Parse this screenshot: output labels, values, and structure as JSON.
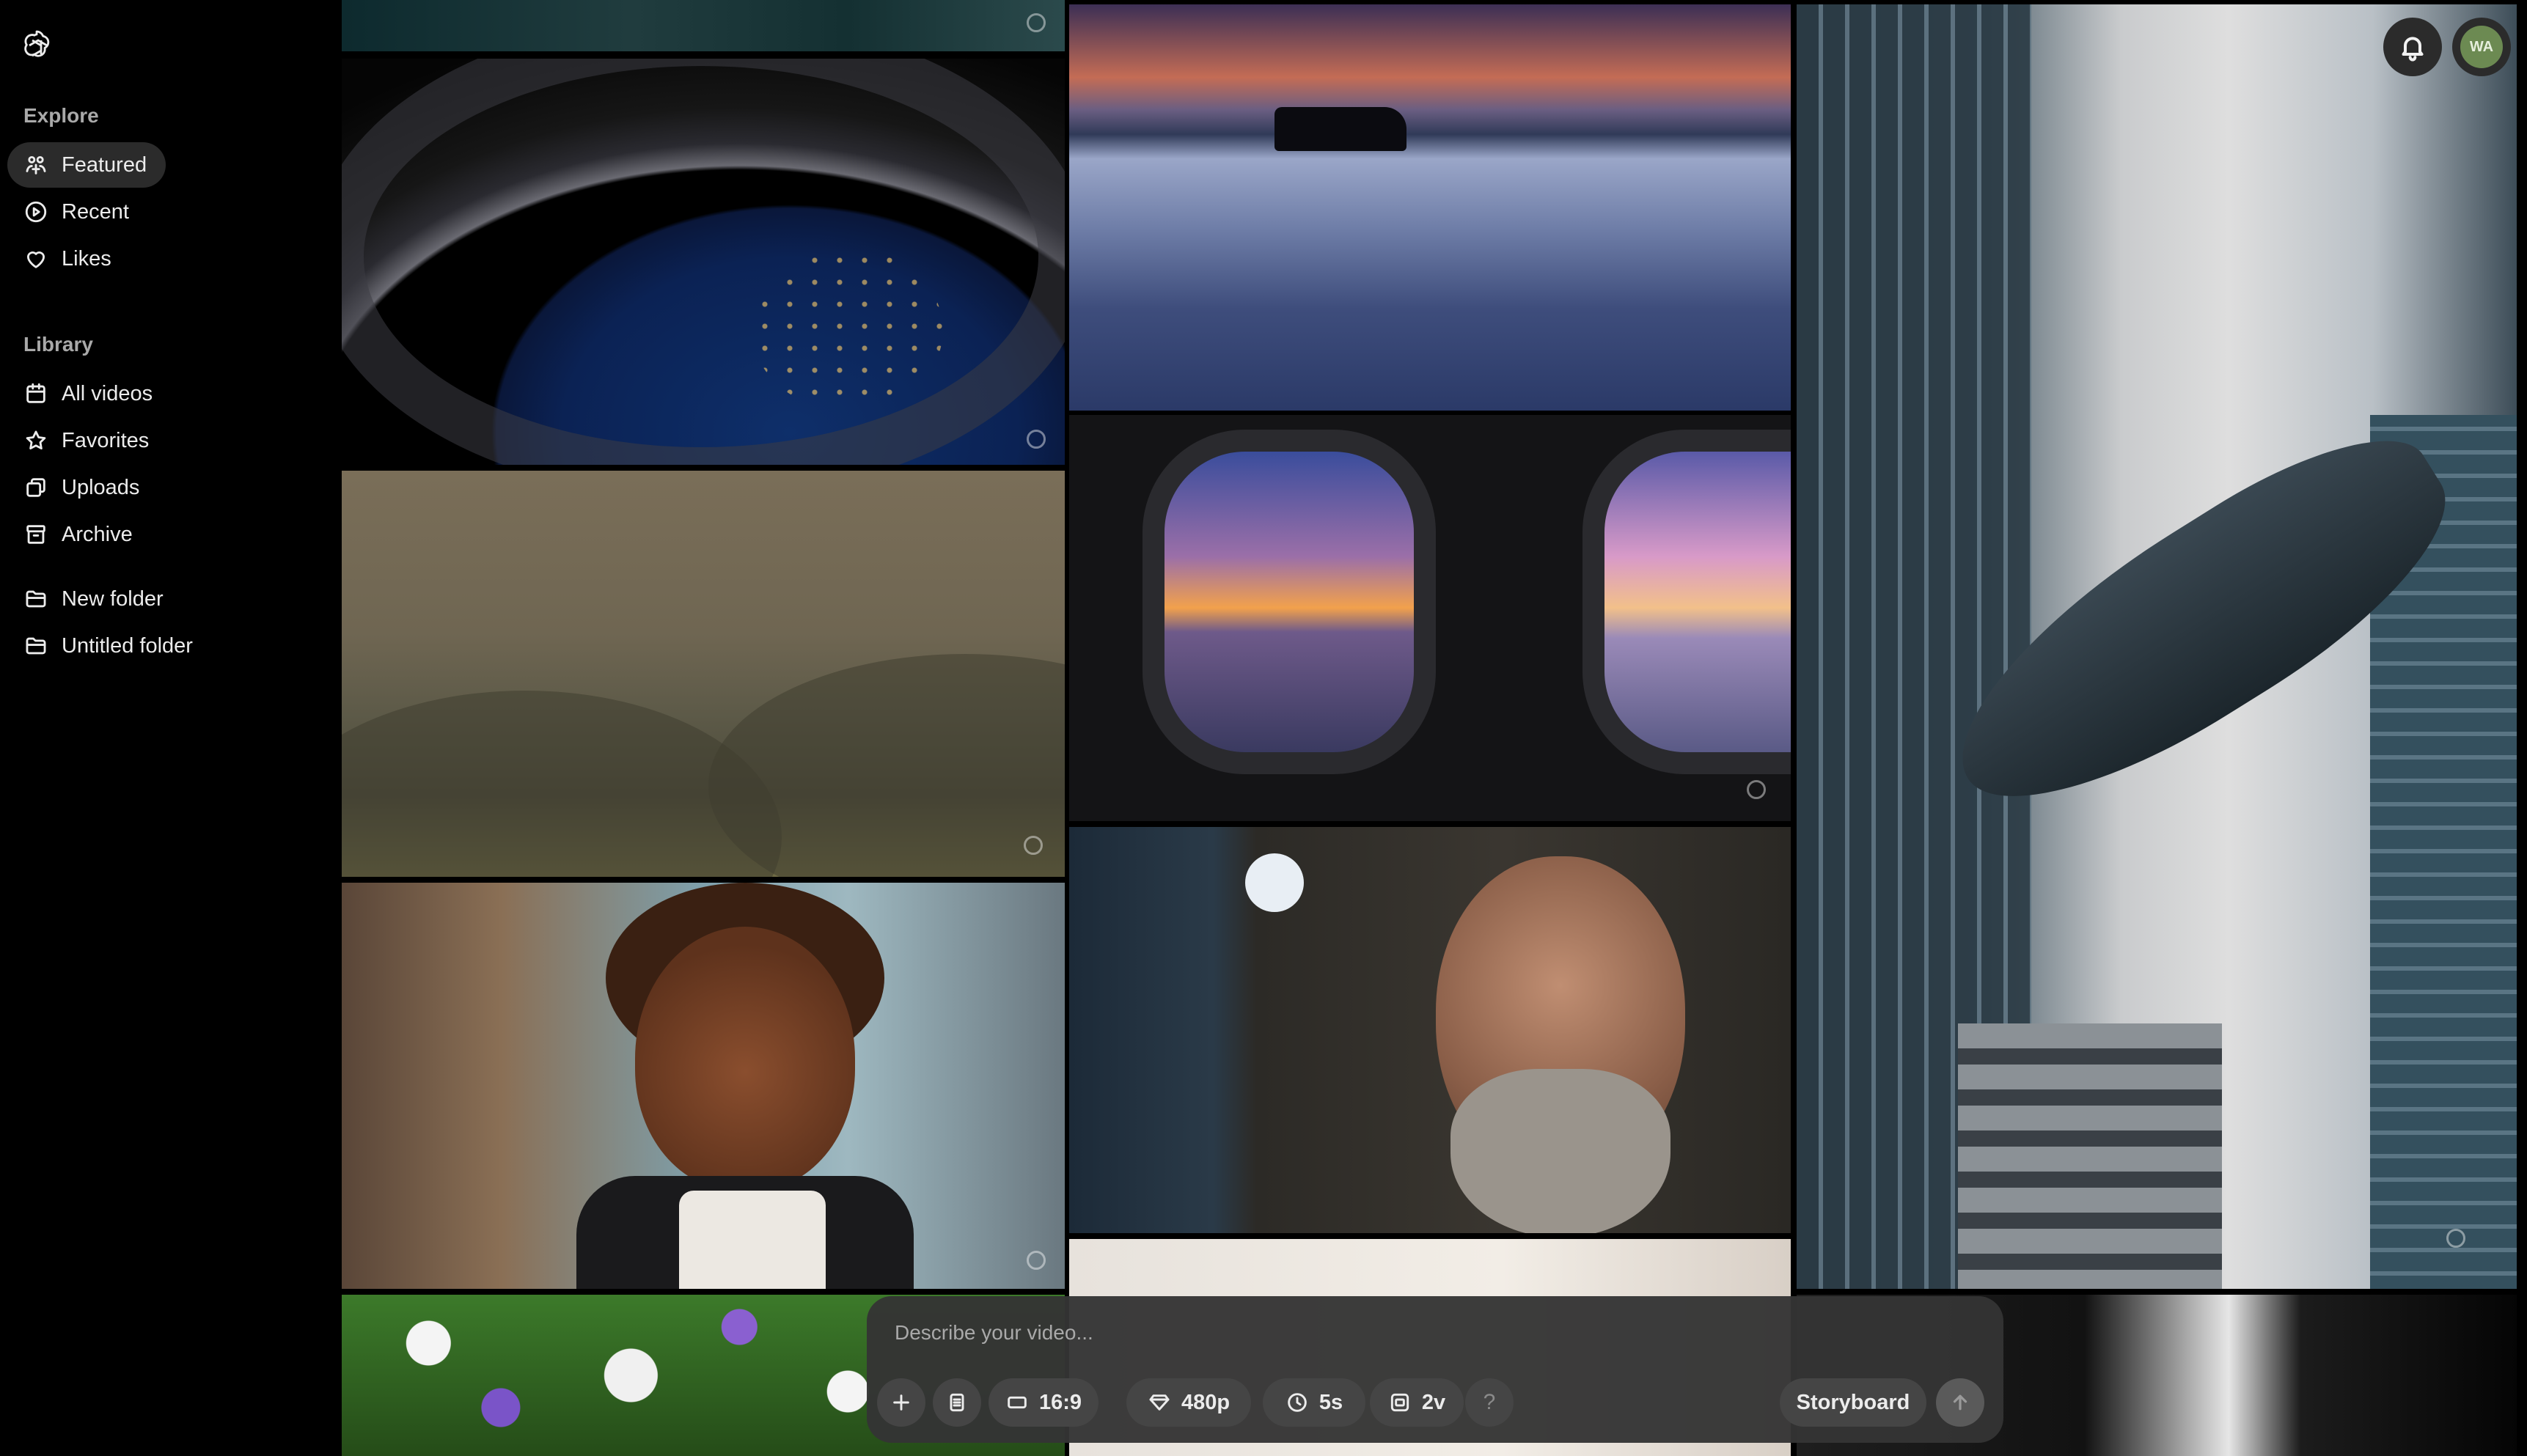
{
  "sidebar": {
    "logo_icon": "openai-logo-icon",
    "explore": {
      "title": "Explore",
      "items": [
        {
          "label": "Featured",
          "icon": "sparkle-people-icon",
          "active": true
        },
        {
          "label": "Recent",
          "icon": "play-circle-icon"
        },
        {
          "label": "Likes",
          "icon": "heart-icon"
        }
      ]
    },
    "library": {
      "title": "Library",
      "items": [
        {
          "label": "All videos",
          "icon": "calendar-grid-icon"
        },
        {
          "label": "Favorites",
          "icon": "star-icon"
        },
        {
          "label": "Uploads",
          "icon": "upload-copy-icon"
        },
        {
          "label": "Archive",
          "icon": "archive-icon"
        }
      ]
    },
    "folders": [
      {
        "label": "New folder",
        "icon": "folder-icon"
      },
      {
        "label": "Untitled folder",
        "icon": "folder-icon"
      }
    ]
  },
  "header": {
    "notifications_icon": "bell-icon",
    "avatar_initials": "WA",
    "avatar_color": "#6c8a52"
  },
  "composer": {
    "placeholder": "Describe your video...",
    "add_icon": "plus-icon",
    "preset_icon": "document-icon",
    "aspect_ratio": "16:9",
    "resolution": "480p",
    "duration": "5s",
    "variations": "2v",
    "help": "?",
    "storyboard_label": "Storyboard",
    "send_icon": "arrow-up-icon"
  }
}
